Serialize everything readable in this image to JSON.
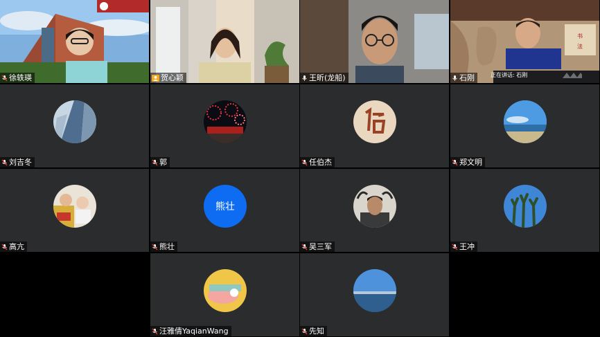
{
  "participants": [
    {
      "name": "徐轶瑛",
      "mic": "muted",
      "kind": "video",
      "scene": "campus"
    },
    {
      "name": "贺心颖",
      "mic": "host",
      "kind": "video",
      "scene": "room"
    },
    {
      "name": "王昕(龙船)",
      "mic": "on",
      "kind": "video",
      "scene": "office"
    },
    {
      "name": "石刚",
      "mic": "on",
      "kind": "video",
      "scene": "calligraphy"
    },
    {
      "name": "刘吉冬",
      "mic": "muted",
      "kind": "avatar",
      "avatar": "skyscraper"
    },
    {
      "name": "郭",
      "mic": "muted",
      "kind": "avatar",
      "avatar": "fireworks"
    },
    {
      "name": "任伯杰",
      "mic": "muted",
      "kind": "avatar",
      "avatar": "seal"
    },
    {
      "name": "郑文明",
      "mic": "muted",
      "kind": "avatar",
      "avatar": "beach"
    },
    {
      "name": "高亢",
      "mic": "muted",
      "kind": "avatar",
      "avatar": "babies"
    },
    {
      "name": "熊壮",
      "mic": "muted",
      "kind": "avatar-text",
      "avatar_text": "熊壮"
    },
    {
      "name": "吴三军",
      "mic": "muted",
      "kind": "avatar",
      "avatar": "portrait"
    },
    {
      "name": "王冲",
      "mic": "muted",
      "kind": "avatar",
      "avatar": "cactus"
    },
    {
      "name": "汪雅倩YaqianWang",
      "mic": "muted",
      "kind": "avatar",
      "avatar": "cartoon"
    },
    {
      "name": "先知",
      "mic": "muted",
      "kind": "avatar",
      "avatar": "sea"
    }
  ],
  "speaking_indicator": "正在讲话: 石刚",
  "colors": {
    "tile_bg": "#2b2c2e",
    "muted_red": "#e8453c",
    "host_orange": "#f5a623",
    "text_avatar_blue": "#0d6cf2"
  }
}
